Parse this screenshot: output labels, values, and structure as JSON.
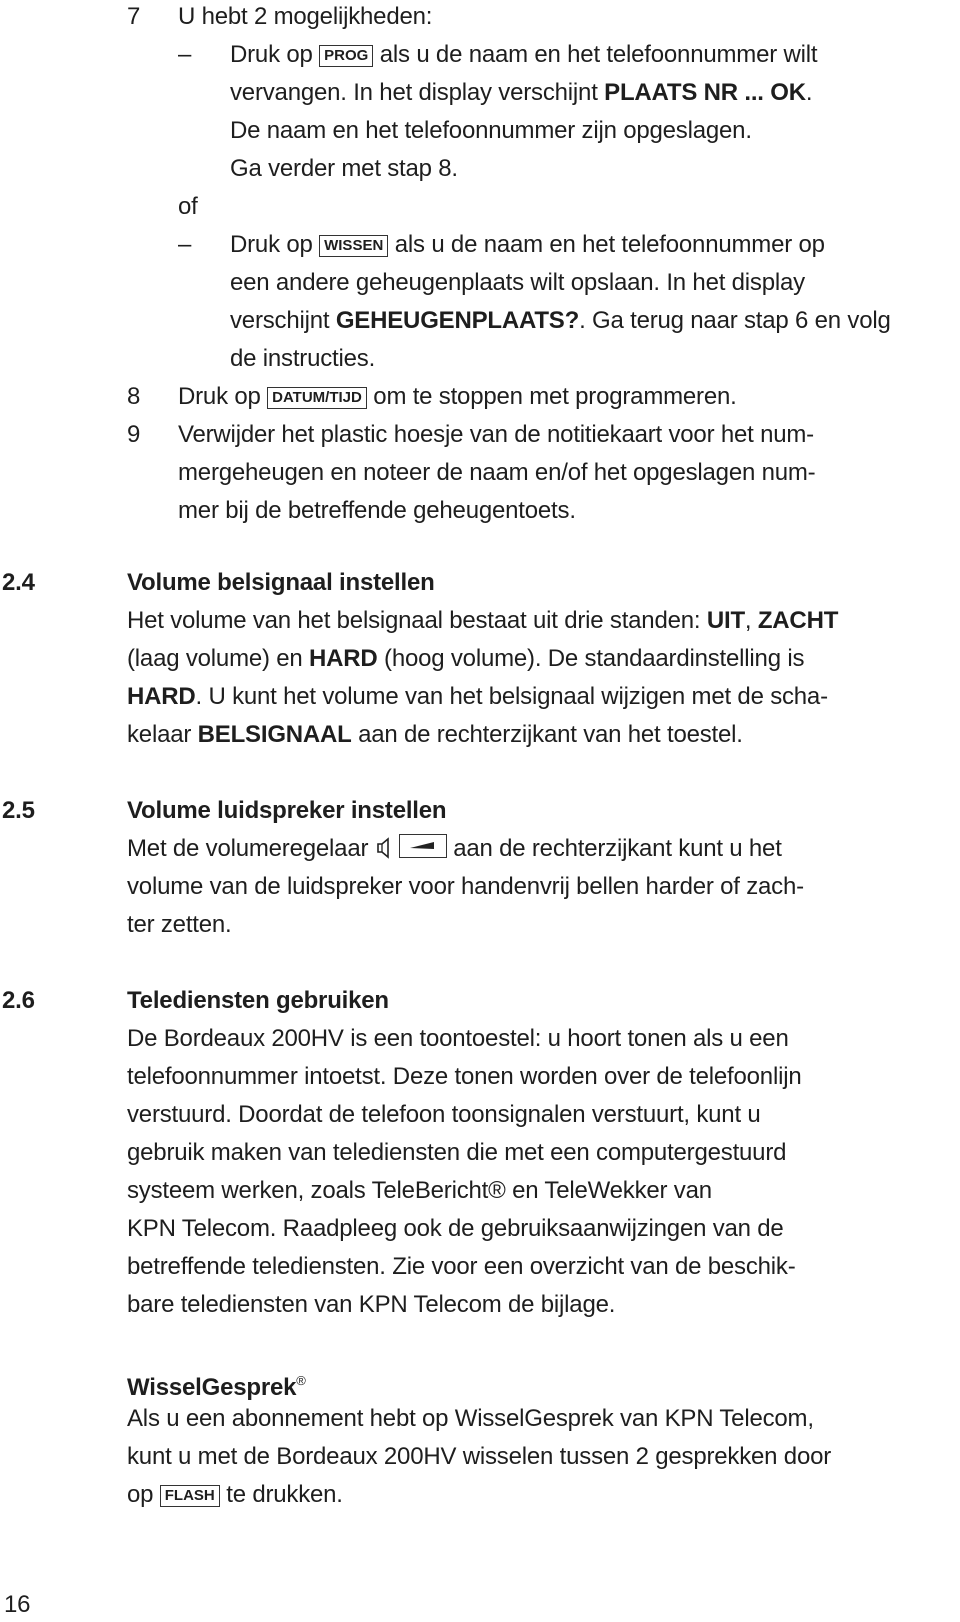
{
  "steps": {
    "s7": {
      "number": "7",
      "intro": "U hebt 2 mogelijkheden:",
      "option1": {
        "dash": "–",
        "l1a": "Druk op ",
        "key": "PROG",
        "l1b": " als u de naam en het telefoonnummer wilt",
        "l2a": "vervangen. In het display verschijnt ",
        "l2bold": "PLAATS NR ... OK",
        "l2b": ".",
        "l3": "De naam en het telefoonnummer zijn opgeslagen.",
        "l4": "Ga verder met stap 8."
      },
      "or": "of",
      "option2": {
        "dash": "–",
        "l1a": "Druk op ",
        "key": "WISSEN",
        "l1b": " als u de naam en het telefoonnummer op",
        "l2": "een andere geheugenplaats wilt opslaan. In het display",
        "l3a": "verschijnt ",
        "l3bold": "GEHEUGENPLAATS?",
        "l3b": ". Ga terug naar stap 6 en volg",
        "l4": "de instructies."
      }
    },
    "s8": {
      "number": "8",
      "a": "Druk op ",
      "key": "DATUM/TIJD",
      "b": " om te stoppen met programmeren."
    },
    "s9": {
      "number": "9",
      "l1": "Verwijder het plastic hoesje van de notitiekaart voor het num-",
      "l2": "mergeheugen en noteer de naam en/of het opgeslagen num-",
      "l3": "mer bij de betreffende geheugentoets."
    }
  },
  "sections": {
    "s24": {
      "number": "2.4",
      "title": "Volume belsignaal instellen",
      "l1a": "Het volume van het belsignaal bestaat uit drie standen: ",
      "l1b1": "UIT",
      "l1c": ", ",
      "l1b2": "ZACHT",
      "l2a": "(laag volume) en ",
      "l2b": "HARD",
      "l2c": " (hoog volume). De standaardinstelling is",
      "l3b": "HARD",
      "l3c": ". U kunt het volume van het belsignaal wijzigen met de scha-",
      "l4a": "kelaar ",
      "l4b": "BELSIGNAAL",
      "l4c": " aan de rechterzijkant van het toestel."
    },
    "s25": {
      "number": "2.5",
      "title": "Volume luidspreker instellen",
      "l1a": "Met de volumeregelaar ",
      "l1b": " aan de rechterzijkant kunt u het",
      "l2": "volume van de luidspreker voor handenvrij bellen harder of zach-",
      "l3": "ter zetten.",
      "icons": [
        "speaker-icon",
        "volume-slider-icon"
      ]
    },
    "s26": {
      "number": "2.6",
      "title": "Telediensten gebruiken",
      "lines": [
        "De Bordeaux 200HV is een toontoestel: u hoort tonen als u een",
        "telefoonnummer intoetst. Deze tonen worden over de telefoonlijn",
        "verstuurd. Doordat de telefoon toonsignalen verstuurt, kunt u",
        "gebruik maken van telediensten die met een computergestuurd",
        "systeem werken, zoals TeleBericht® en TeleWekker van",
        "KPN Telecom. Raadpleeg ook de gebruiksaanwijzingen van de",
        "betreffende telediensten. Zie voor een overzicht van de beschik-",
        "bare telediensten van KPN Telecom de bijlage."
      ]
    },
    "wissel": {
      "title": "WisselGesprek",
      "reg": "®",
      "l1": "Als u een abonnement hebt op WisselGesprek van KPN Telecom,",
      "l2": "kunt u met de Bordeaux 200HV wisselen tussen 2 gesprekken door",
      "l3a": "op ",
      "key": "FLASH",
      "l3b": " te drukken."
    }
  },
  "footer": {
    "page_number": "16"
  }
}
